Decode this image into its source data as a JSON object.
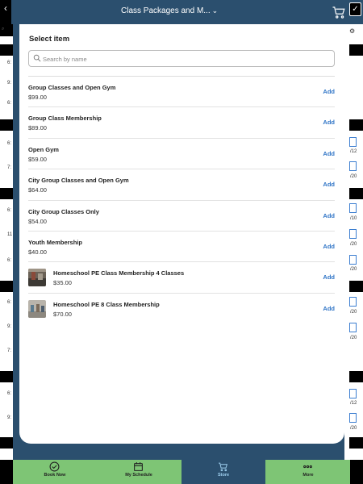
{
  "header": {
    "title": "Class Packages and M...",
    "back_icon": "chevron-left-icon",
    "cart_icon": "cart-icon",
    "calendar_icon": "calendar-check-icon"
  },
  "background": {
    "left_times": [
      "6:",
      "9:",
      "6:",
      "6:",
      "7:",
      "6:",
      "11",
      "6:",
      "6:",
      "9:",
      "7:",
      "6:",
      "9:"
    ],
    "right_dates": [
      "/12",
      "/20",
      "/10",
      "/20",
      "/20",
      "/20",
      "/20",
      "/12",
      "/20"
    ]
  },
  "sheet": {
    "title": "Select item",
    "search_placeholder": "Search by name",
    "add_label": "Add",
    "items": [
      {
        "name": "Group Classes and Open Gym",
        "price": "$99.00"
      },
      {
        "name": "Group Class Membership",
        "price": "$89.00"
      },
      {
        "name": "Open Gym",
        "price": "$59.00"
      },
      {
        "name": "City Group Classes and Open Gym",
        "price": "$64.00"
      },
      {
        "name": "City Group Classes Only",
        "price": "$54.00"
      },
      {
        "name": "Youth Membership",
        "price": "$40.00"
      },
      {
        "name": "Homeschool PE Class Membership 4 Classes",
        "price": "$35.00"
      },
      {
        "name": "Homeschool PE 8 Class Membership",
        "price": "$70.00"
      }
    ]
  },
  "tabs": [
    {
      "label": "Book Now",
      "icon": "check-circle-icon"
    },
    {
      "label": "My Schedule",
      "icon": "calendar-icon"
    },
    {
      "label": "Store",
      "icon": "cart-icon",
      "active": true
    },
    {
      "label": "More",
      "icon": "more-dots-icon"
    }
  ],
  "colors": {
    "header_bg": "#2b4f6e",
    "tabbar_bg": "#7ec575",
    "accent": "#2f74c6"
  }
}
